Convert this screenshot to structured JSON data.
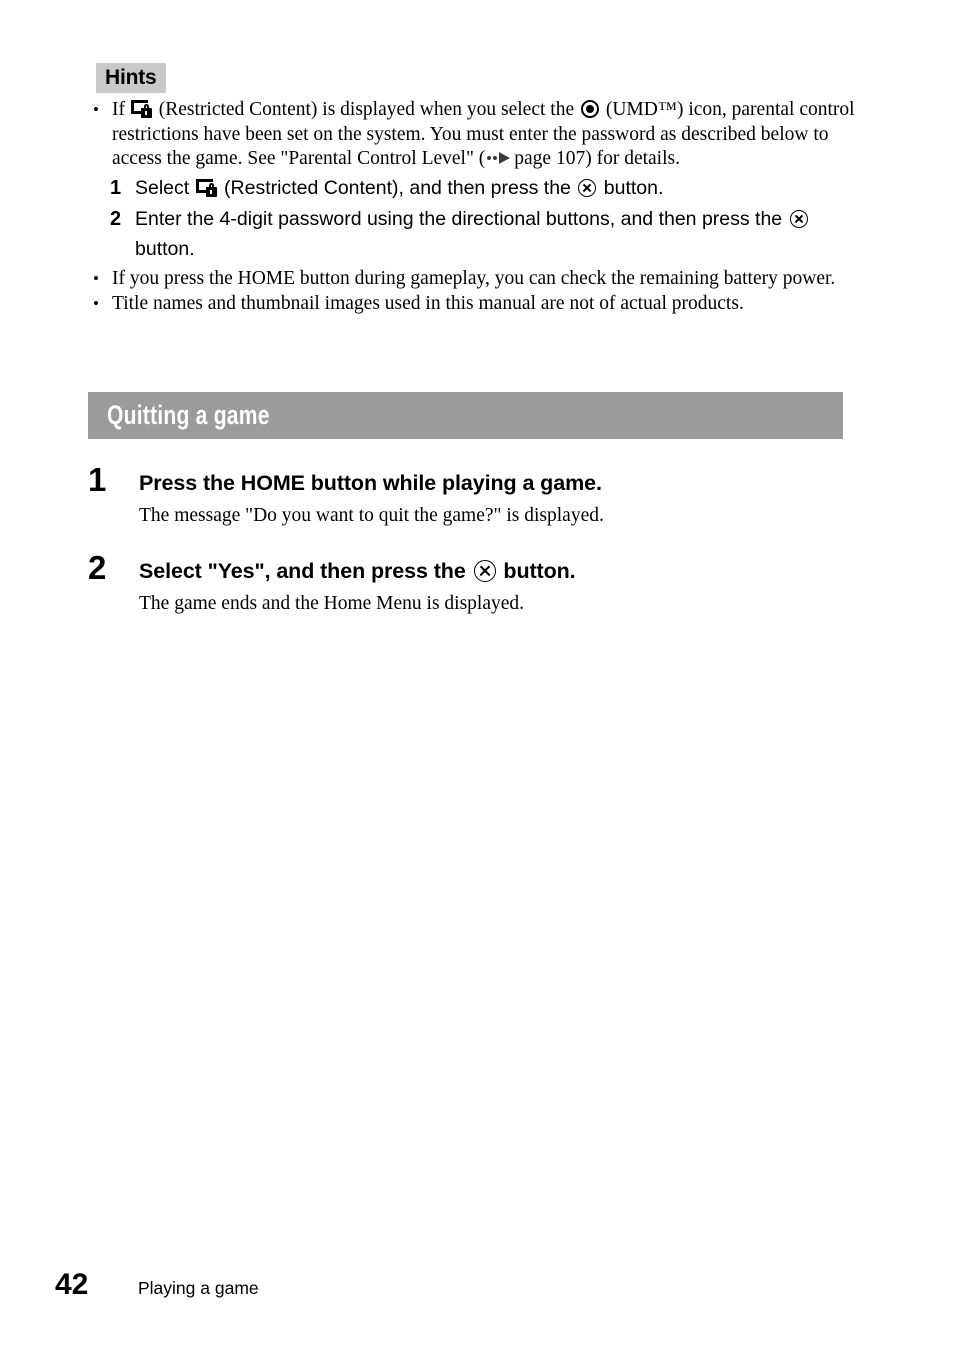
{
  "hints": {
    "label": "Hints",
    "bullet1": {
      "pre_icon_text": "If",
      "restricted_icon": "restricted-content-icon",
      "after_restricted": "(Restricted Content) is displayed when you select the",
      "umd_icon": "umd-disc-icon",
      "after_umd": "(UMD™) icon, parental control restrictions have been set on the system. You must enter the password as described below to access the game. See \"Parental Control Level\" (",
      "see_page_icon": "see-page-arrow-icon",
      "page_reference": "page 107",
      "tail": ") for details."
    },
    "substeps": [
      {
        "number": "1",
        "pre": "Select",
        "icon": "restricted-content-icon",
        "mid": "(Restricted Content), and then press the",
        "button_icon": "cross-button-icon",
        "post": "button."
      },
      {
        "number": "2",
        "pre": "Enter the 4-digit password using the directional buttons, and then press the",
        "icon": null,
        "mid": "",
        "button_icon": "cross-button-icon",
        "post": "button."
      }
    ],
    "bullet2": "If you press the HOME button during gameplay, you can check the remaining battery power.",
    "bullet3": "Title names and thumbnail images used in this manual are not of actual products."
  },
  "section": {
    "title": "Quitting a game",
    "banner_color": "#9b9b9b",
    "steps": [
      {
        "number": "1",
        "heading_pre": "Press the HOME button while playing a game.",
        "heading_icon": null,
        "heading_post": "",
        "description": "The message \"Do you want to quit the game?\" is displayed."
      },
      {
        "number": "2",
        "heading_pre": "Select \"Yes\", and then press the",
        "heading_icon": "cross-button-icon",
        "heading_post": "button.",
        "description": "The game ends and the Home Menu is displayed."
      }
    ]
  },
  "footer": {
    "page_number": "42",
    "breadcrumb": "Playing a game"
  }
}
